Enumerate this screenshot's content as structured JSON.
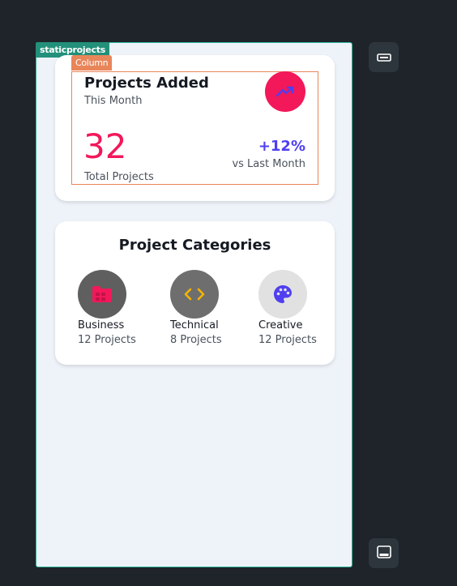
{
  "frame": {
    "label": "staticprojects",
    "column_label": "Column"
  },
  "projects_card": {
    "title": "Projects Added",
    "subtitle": "This Month",
    "icon": "trending-up-icon",
    "count": "32",
    "count_label": "Total Projects",
    "change": "+12%",
    "change_label": "vs Last Month"
  },
  "categories_card": {
    "title": "Project Categories",
    "items": [
      {
        "name": "Business",
        "count": "12 Projects",
        "icon": "folder-icon",
        "icon_color": "#f2185a",
        "bg_color": "#5f5f5f"
      },
      {
        "name": "Technical",
        "count": "8 Projects",
        "icon": "code-icon",
        "icon_color": "#f5b400",
        "bg_color": "#6e6e6e"
      },
      {
        "name": "Creative",
        "count": "12 Projects",
        "icon": "palette-icon",
        "icon_color": "#4f3ff0",
        "bg_color": "#e1e1e1"
      }
    ]
  },
  "side_buttons": [
    {
      "icon": "toggle-icon"
    },
    {
      "icon": "panel-bottom-icon"
    }
  ],
  "colors": {
    "accent_pink": "#f2185a",
    "accent_indigo": "#4f3ff0",
    "frame_border": "#2fb59b",
    "column_border": "#e8865a"
  }
}
